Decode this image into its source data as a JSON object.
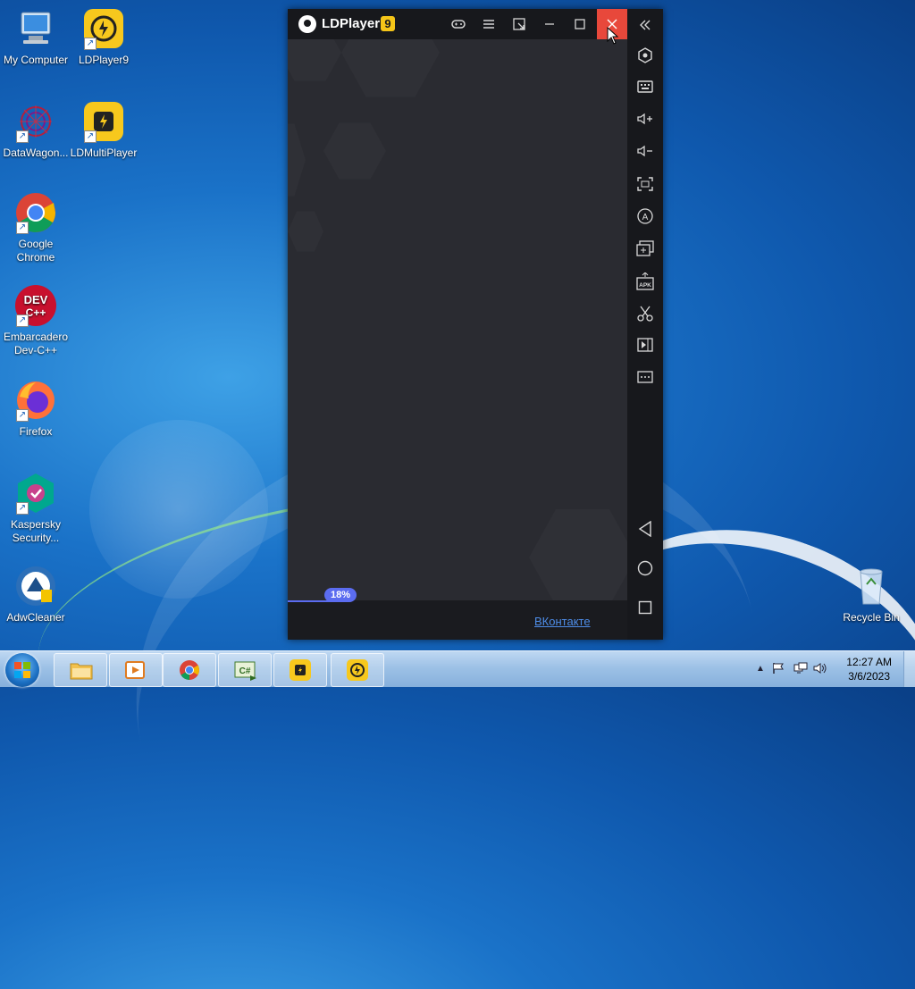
{
  "desktop": {
    "icons": [
      {
        "label": "My Computer"
      },
      {
        "label": "LDPlayer9"
      },
      {
        "label": "DataWagon..."
      },
      {
        "label": "LDMultiPlayer"
      },
      {
        "label": "Google Chrome"
      },
      {
        "label": "Embarcadero Dev-C++"
      },
      {
        "label": "Firefox"
      },
      {
        "label": "Kaspersky Security..."
      },
      {
        "label": "AdwCleaner"
      },
      {
        "label": "Recycle Bin"
      }
    ]
  },
  "ldplayer": {
    "title": "LDPlayer",
    "version_badge": "9",
    "titlebar_buttons": [
      "gamepad-icon",
      "menu-icon",
      "fullscreen-icon",
      "minimize-icon",
      "maximize-icon",
      "close-icon"
    ],
    "sidebar_buttons": [
      {
        "name": "collapse",
        "glyph": "«"
      },
      {
        "name": "settings",
        "glyph": "⬡"
      },
      {
        "name": "keyboard",
        "glyph": "⌨"
      },
      {
        "name": "volume-up",
        "glyph": "🔊+"
      },
      {
        "name": "volume-down",
        "glyph": "🔉−"
      },
      {
        "name": "screenshot",
        "glyph": "⛶"
      },
      {
        "name": "auto-rotate",
        "glyph": "Ⓐ"
      },
      {
        "name": "add-instance",
        "glyph": "⊞"
      },
      {
        "name": "install-apk",
        "glyph": "APK"
      },
      {
        "name": "cut",
        "glyph": "✂"
      },
      {
        "name": "record",
        "glyph": "▶"
      },
      {
        "name": "more",
        "glyph": "⋯"
      }
    ],
    "nav_buttons": [
      {
        "name": "back",
        "glyph": "◁"
      },
      {
        "name": "home",
        "glyph": "○"
      },
      {
        "name": "recents",
        "glyph": "□"
      }
    ],
    "progress": {
      "label": "18%",
      "value": 0.18
    },
    "bottom_link": "ВКонтакте"
  },
  "taskbar": {
    "pinned": [
      "explorer",
      "media-player",
      "chrome",
      "csharp",
      "ldmultiplayer",
      "ldplayer"
    ],
    "clock": {
      "time": "12:27 AM",
      "date": "3/6/2023"
    }
  }
}
